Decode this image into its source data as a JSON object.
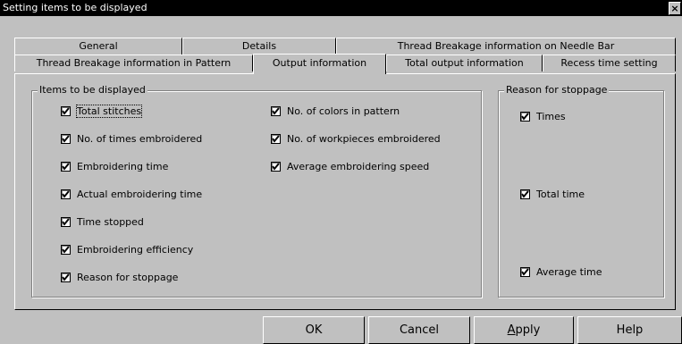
{
  "window": {
    "title": "Setting items to be displayed",
    "close_glyph": "×"
  },
  "tabs": {
    "row1": [
      {
        "label": "General"
      },
      {
        "label": "Details"
      },
      {
        "label": "Thread Breakage information on Needle Bar"
      }
    ],
    "row2": [
      {
        "label": "Thread Breakage information in Pattern"
      },
      {
        "label": "Output information",
        "active": true
      },
      {
        "label": "Total output information"
      },
      {
        "label": "Recess time setting"
      }
    ]
  },
  "items_group": {
    "title": "Items to be displayed",
    "column1": [
      {
        "label": "Total stitches",
        "checked": true
      },
      {
        "label": "No. of times embroidered",
        "checked": true
      },
      {
        "label": "Embroidering time",
        "checked": true
      },
      {
        "label": "Actual embroidering time",
        "checked": true
      },
      {
        "label": "Time stopped",
        "checked": true
      },
      {
        "label": "Embroidering efficiency",
        "checked": true
      },
      {
        "label": "Reason for stoppage",
        "checked": true
      }
    ],
    "column2": [
      {
        "label": "No. of colors in pattern",
        "checked": true
      },
      {
        "label": "No. of workpieces embroidered",
        "checked": true
      },
      {
        "label": "Average embroidering speed",
        "checked": true
      }
    ]
  },
  "reason_group": {
    "title": "Reason for stoppage",
    "items": [
      {
        "label": "Times",
        "checked": true
      },
      {
        "label": "Total time",
        "checked": true
      },
      {
        "label": "Average time",
        "checked": true
      }
    ]
  },
  "buttons": {
    "ok": "OK",
    "cancel": "Cancel",
    "apply_mnemonic": "A",
    "apply_rest": "pply",
    "help": "Help"
  }
}
